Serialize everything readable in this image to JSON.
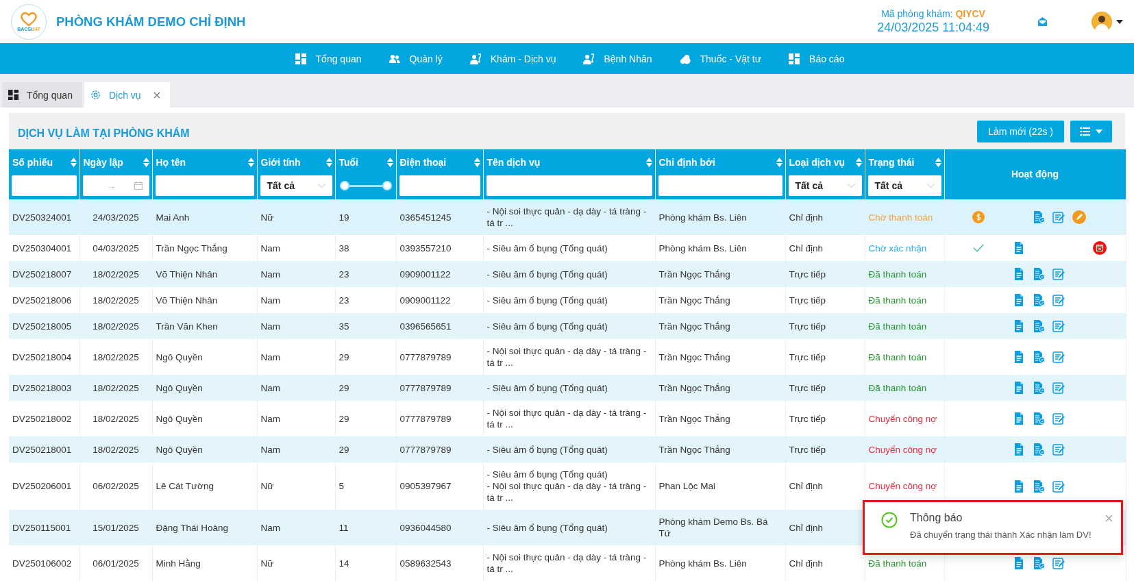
{
  "header": {
    "logo": {
      "text": "BACSI",
      "suffix": "247"
    },
    "clinic_name": "PHÒNG KHÁM DEMO CHỈ ĐỊNH",
    "clinic_code_label": "Mã phòng khám:",
    "clinic_code": "QIYCV",
    "datetime": "24/03/2025 11:04:49"
  },
  "nav": [
    {
      "label": "Tổng quan",
      "kind": "dashboard"
    },
    {
      "label": "Quản lý",
      "kind": "users"
    },
    {
      "label": "Khám - Dịch vụ",
      "kind": "doctor"
    },
    {
      "label": "Bệnh Nhân",
      "kind": "doctor"
    },
    {
      "label": "Thuốc - Vật tư",
      "kind": "pills"
    },
    {
      "label": "Báo cáo",
      "kind": "dashboard"
    }
  ],
  "tabs": [
    {
      "label": "Tổng quan",
      "kind": "dashboard",
      "selected": false,
      "closable": false
    },
    {
      "label": "Dịch vụ",
      "kind": "gear",
      "selected": true,
      "closable": true
    }
  ],
  "panel": {
    "title": "DỊCH VỤ LÀM TẠI PHÒNG KHÁM",
    "refresh_button": "Làm mới (22s )"
  },
  "table": {
    "columns": [
      {
        "label": "Số phiếu",
        "sortable": true,
        "filter": {
          "kind": "text"
        }
      },
      {
        "label": "Ngày lập",
        "sortable": true,
        "filter": {
          "kind": "date",
          "separator": "→"
        }
      },
      {
        "label": "Họ tên",
        "sortable": true,
        "filter": {
          "kind": "text"
        }
      },
      {
        "label": "Giới tính",
        "sortable": true,
        "filter": {
          "kind": "select",
          "value": "Tất cả"
        }
      },
      {
        "label": "Tuổi",
        "sortable": true,
        "filter": {
          "kind": "range"
        }
      },
      {
        "label": "Điện thoại",
        "sortable": true,
        "filter": {
          "kind": "text"
        }
      },
      {
        "label": "Tên dịch vụ",
        "sortable": true,
        "filter": {
          "kind": "text"
        }
      },
      {
        "label": "Chỉ định bởi",
        "sortable": true,
        "filter": {
          "kind": "text"
        }
      },
      {
        "label": "Loại dịch vụ",
        "sortable": true,
        "filter": {
          "kind": "select",
          "value": "Tất cả"
        }
      },
      {
        "label": "Trạng thái",
        "sortable": true,
        "filter": {
          "kind": "select",
          "value": "Tất cả"
        }
      },
      {
        "label": "Hoạt động",
        "sortable": false
      }
    ],
    "rows": [
      {
        "code": "DV250324001",
        "date": "24/03/2025",
        "name": "Mai Anh",
        "gender": "Nữ",
        "age": "19",
        "phone": "0365451245",
        "services": [
          "- Nội soi thực quản - dạ dày - tá tràng - tá tr ..."
        ],
        "ordered_by": "Phòng khám Bs. Liên",
        "type": "Chỉ định",
        "status": {
          "text": "Chờ thanh toán",
          "color": "#f5a13c"
        },
        "actions": [
          {
            "kind": "money"
          },
          {
            "kind": "doc-check"
          },
          {
            "kind": "edit"
          },
          {
            "kind": "pencil"
          }
        ]
      },
      {
        "code": "DV250304001",
        "date": "04/03/2025",
        "name": "Trần Ngọc Thắng",
        "gender": "Nam",
        "age": "38",
        "phone": "0393557210",
        "services": [
          "- Siêu âm ổ bụng (Tổng quát)"
        ],
        "ordered_by": "Phòng khám Bs. Liên",
        "type": "Chỉ định",
        "status": {
          "text": "Chờ xác nhận",
          "color": "#2aa8e8"
        },
        "actions": [
          {
            "kind": "check"
          },
          {
            "kind": "doc"
          },
          {
            "kind": "cancel"
          }
        ]
      },
      {
        "code": "DV250218007",
        "date": "18/02/2025",
        "name": "Võ Thiện Nhân",
        "gender": "Nam",
        "age": "23",
        "phone": "0909001122",
        "services": [
          "- Siêu âm ổ bụng (Tổng quát)"
        ],
        "ordered_by": "Trần Ngọc Thắng",
        "type": "Trực tiếp",
        "status": {
          "text": "Đã thanh toán",
          "color": "#23932b"
        },
        "actions": [
          {
            "kind": "doc"
          },
          {
            "kind": "doc-check"
          },
          {
            "kind": "edit"
          }
        ]
      },
      {
        "code": "DV250218006",
        "date": "18/02/2025",
        "name": "Võ Thiện Nhân",
        "gender": "Nam",
        "age": "23",
        "phone": "0909001122",
        "services": [
          "- Siêu âm ổ bụng (Tổng quát)"
        ],
        "ordered_by": "Trần Ngọc Thắng",
        "type": "Trực tiếp",
        "status": {
          "text": "Đã thanh toán",
          "color": "#23932b"
        },
        "actions": [
          {
            "kind": "doc"
          },
          {
            "kind": "doc-check"
          },
          {
            "kind": "edit"
          }
        ]
      },
      {
        "code": "DV250218005",
        "date": "18/02/2025",
        "name": "Trần Văn Khen",
        "gender": "Nam",
        "age": "35",
        "phone": "0396565651",
        "services": [
          "- Siêu âm ổ bụng (Tổng quát)"
        ],
        "ordered_by": "Trần Ngọc Thắng",
        "type": "Trực tiếp",
        "status": {
          "text": "Đã thanh toán",
          "color": "#23932b"
        },
        "actions": [
          {
            "kind": "doc"
          },
          {
            "kind": "doc-check"
          },
          {
            "kind": "edit"
          }
        ]
      },
      {
        "code": "DV250218004",
        "date": "18/02/2025",
        "name": "Ngô Quyền",
        "gender": "Nam",
        "age": "29",
        "phone": "0777879789",
        "services": [
          "- Nội soi thực quản - dạ dày - tá tràng - tá tr ..."
        ],
        "ordered_by": "Trần Ngọc Thắng",
        "type": "Trực tiếp",
        "status": {
          "text": "Đã thanh toán",
          "color": "#23932b"
        },
        "actions": [
          {
            "kind": "doc"
          },
          {
            "kind": "doc-check"
          },
          {
            "kind": "edit"
          }
        ]
      },
      {
        "code": "DV250218003",
        "date": "18/02/2025",
        "name": "Ngô Quyền",
        "gender": "Nam",
        "age": "29",
        "phone": "0777879789",
        "services": [
          "- Siêu âm ổ bụng (Tổng quát)"
        ],
        "ordered_by": "Trần Ngọc Thắng",
        "type": "Trực tiếp",
        "status": {
          "text": "Đã thanh toán",
          "color": "#23932b"
        },
        "actions": [
          {
            "kind": "doc"
          },
          {
            "kind": "doc-check"
          },
          {
            "kind": "edit"
          }
        ]
      },
      {
        "code": "DV250218002",
        "date": "18/02/2025",
        "name": "Ngô Quyền",
        "gender": "Nam",
        "age": "29",
        "phone": "0777879789",
        "services": [
          "- Nội soi thực quản - dạ dày - tá tràng - tá tr ..."
        ],
        "ordered_by": "Trần Ngọc Thắng",
        "type": "Trực tiếp",
        "status": {
          "text": "Chuyển công nợ",
          "color": "#f2283c"
        },
        "actions": [
          {
            "kind": "doc"
          },
          {
            "kind": "doc-check"
          },
          {
            "kind": "edit"
          }
        ]
      },
      {
        "code": "DV250218001",
        "date": "18/02/2025",
        "name": "Ngô Quyền",
        "gender": "Nam",
        "age": "29",
        "phone": "0777879789",
        "services": [
          "- Siêu âm ổ bụng (Tổng quát)"
        ],
        "ordered_by": "Trần Ngọc Thắng",
        "type": "Trực tiếp",
        "status": {
          "text": "Chuyển công nợ",
          "color": "#f2283c"
        },
        "actions": [
          {
            "kind": "doc"
          },
          {
            "kind": "doc-check"
          },
          {
            "kind": "edit"
          }
        ]
      },
      {
        "code": "DV250206001",
        "date": "06/02/2025",
        "name": "Lê Cát Tường",
        "gender": "Nữ",
        "age": "5",
        "phone": "0905397967",
        "services": [
          "- Siêu âm ổ bụng (Tổng quát)",
          "- Nội soi thực quản - dạ dày - tá tràng - tá tr ..."
        ],
        "ordered_by": "Phan Lộc Mai",
        "type": "Chỉ định",
        "status": {
          "text": "Chuyển công nợ",
          "color": "#f2283c"
        },
        "actions": [
          {
            "kind": "doc"
          },
          {
            "kind": "doc-check"
          },
          {
            "kind": "edit"
          }
        ]
      },
      {
        "code": "DV250115001",
        "date": "15/01/2025",
        "name": "Đặng Thái Hoàng",
        "gender": "Nam",
        "age": "11",
        "phone": "0936044580",
        "services": [
          "- Siêu âm ổ bụng (Tổng quát)"
        ],
        "ordered_by": "Phòng khám Demo Bs. Bá Tứ",
        "type": "Chỉ định"
      },
      {
        "code": "DV250106002",
        "date": "06/01/2025",
        "name": "Minh Hằng",
        "gender": "Nữ",
        "age": "14",
        "phone": "0589632543",
        "services": [
          "- Nội soi thực quản - dạ dày - tá tràng - tá tr ..."
        ],
        "ordered_by": "Phòng khám Bs. Liên",
        "type": "Chỉ định",
        "status": {
          "text": "Đã thanh toán",
          "color": "#23932b"
        },
        "actions": [
          {
            "kind": "doc"
          },
          {
            "kind": "doc-check"
          },
          {
            "kind": "edit"
          }
        ]
      }
    ]
  },
  "toast": {
    "title": "Thông báo",
    "message": "Đã chuyển trạng thái thành Xác nhận làm DV!",
    "highlighted": true
  }
}
